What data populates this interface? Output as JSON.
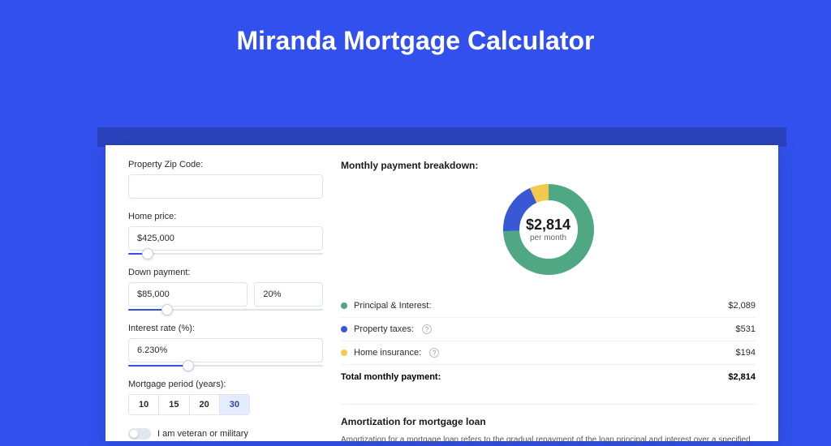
{
  "title": "Miranda Mortgage Calculator",
  "colors": {
    "accent": "#3150ed",
    "green": "#4fa783",
    "blue": "#3858d6",
    "yellow": "#f2c94c"
  },
  "form": {
    "zip": {
      "label": "Property Zip Code:",
      "value": ""
    },
    "home_price": {
      "label": "Home price:",
      "value": "$425,000",
      "slider_pct": 10
    },
    "down_payment": {
      "label": "Down payment:",
      "amount": "$85,000",
      "pct": "20%",
      "slider_pct": 20
    },
    "interest": {
      "label": "Interest rate (%):",
      "value": "6.230%",
      "slider_pct": 31
    },
    "period": {
      "label": "Mortgage period (years):",
      "options": [
        "10",
        "15",
        "20",
        "30"
      ],
      "selected": "30"
    },
    "veteran": {
      "label": "I am veteran or military",
      "checked": false
    }
  },
  "breakdown": {
    "title": "Monthly payment breakdown:",
    "donut_amount": "$2,814",
    "donut_sub": "per month",
    "items": [
      {
        "label": "Principal & Interest:",
        "value": "$2,089",
        "color": "#4fa783",
        "info": false
      },
      {
        "label": "Property taxes:",
        "value": "$531",
        "color": "#3858d6",
        "info": true
      },
      {
        "label": "Home insurance:",
        "value": "$194",
        "color": "#f2c94c",
        "info": true
      }
    ],
    "total_label": "Total monthly payment:",
    "total_value": "$2,814"
  },
  "chart_data": {
    "type": "pie",
    "title": "Monthly payment breakdown",
    "series": [
      {
        "name": "Principal & Interest",
        "value": 2089,
        "color": "#4fa783"
      },
      {
        "name": "Property taxes",
        "value": 531,
        "color": "#3858d6"
      },
      {
        "name": "Home insurance",
        "value": 194,
        "color": "#f2c94c"
      }
    ],
    "total": 2814,
    "center_label": "$2,814 per month"
  },
  "amort": {
    "title": "Amortization for mortgage loan",
    "text": "Amortization for a mortgage loan refers to the gradual repayment of the loan principal and interest over a specified"
  }
}
